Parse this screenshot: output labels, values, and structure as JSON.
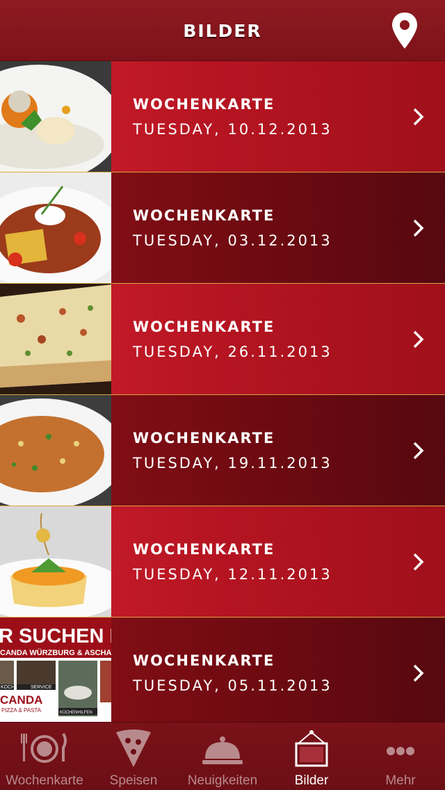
{
  "header": {
    "title": "BILDER",
    "location_icon": "map-pin-icon"
  },
  "rows": [
    {
      "title": "WOCHENKARTE",
      "date": "TUESDAY, 10.12.2013"
    },
    {
      "title": "WOCHENKARTE",
      "date": "TUESDAY, 03.12.2013"
    },
    {
      "title": "WOCHENKARTE",
      "date": "TUESDAY, 26.11.2013"
    },
    {
      "title": "WOCHENKARTE",
      "date": "TUESDAY, 19.11.2013"
    },
    {
      "title": "WOCHENKARTE",
      "date": "TUESDAY, 12.11.2013"
    },
    {
      "title": "WOCHENKARTE",
      "date": "TUESDAY, 05.11.2013"
    }
  ],
  "poster": {
    "headline": "R SUCHEN DI",
    "subline": "CANDA WÜRZBURG & ASCHAFF",
    "brand": "CANDA",
    "brand_sub": "PIZZA & PASTA",
    "labels": [
      "KOCH",
      "SERVICE",
      "KÜCHENHILFEN"
    ]
  },
  "tabbar": {
    "tabs": [
      {
        "label": "Wochenkarte",
        "icon": "plate-cutlery-icon",
        "active": false
      },
      {
        "label": "Speisen",
        "icon": "pizza-slice-icon",
        "active": false
      },
      {
        "label": "Neuigkeiten",
        "icon": "cloche-icon",
        "active": false
      },
      {
        "label": "Bilder",
        "icon": "picture-frame-icon",
        "active": true
      },
      {
        "label": "Mehr",
        "icon": "more-dots-icon",
        "active": false
      }
    ]
  },
  "colors": {
    "row_light": "#cf1f2e",
    "row_dark": "#6e0a11",
    "separator": "#d8a742",
    "header": "#8a171f",
    "tab_inactive": "#b98a8d"
  }
}
